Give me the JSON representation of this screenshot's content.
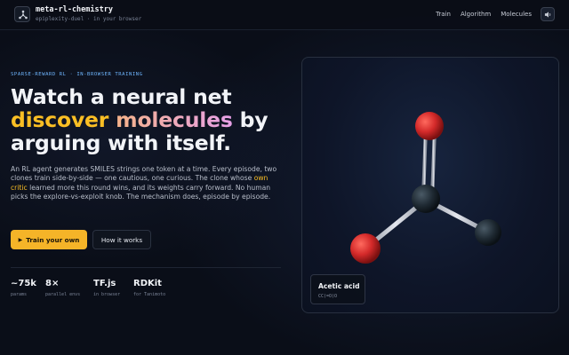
{
  "header": {
    "brand_name": "meta-rl-chemistry",
    "brand_sub": "epiplexity-duel · in your browser",
    "nav": [
      "Train",
      "Algorithm",
      "Molecules"
    ],
    "sound_icon": "speaker-icon"
  },
  "hero": {
    "eyebrow": "SPARSE-REWARD RL · IN-BROWSER TRAINING",
    "headline_part1": "Watch a neural net",
    "headline_highlight1": "discover",
    "headline_highlight2": "molecules",
    "headline_part2": " by arguing with itself.",
    "desc_part1": "An RL agent generates SMILES strings one token at a time. Every episode, two clones train side-by-side — one cautious, one curious. The clone whose ",
    "desc_highlight": "own critic",
    "desc_part2": " learned more this round wins, and its weights carry forward. No human picks the explore-vs-exploit knob. The mechanism does, episode by episode.",
    "primary_button": "Train your own",
    "primary_button_icon": "▶",
    "secondary_button": "How it works"
  },
  "stats": [
    {
      "value": "~75k",
      "label": "params"
    },
    {
      "value": "8×",
      "label": "parallel envs"
    },
    {
      "value": "TF.js",
      "label": "in browser"
    },
    {
      "value": "RDKit",
      "label": "for Tanimoto"
    }
  ],
  "viewer": {
    "molecule_name": "Acetic acid",
    "smiles": "CC(=O)O",
    "colors": {
      "oxygen": "#d42a2a",
      "carbon": "#1f2a33",
      "bond": "#c8ccd4"
    }
  },
  "colors": {
    "accent": "#f5b428",
    "eyebrow": "#6fb6ff",
    "background": "#0a0e18"
  }
}
